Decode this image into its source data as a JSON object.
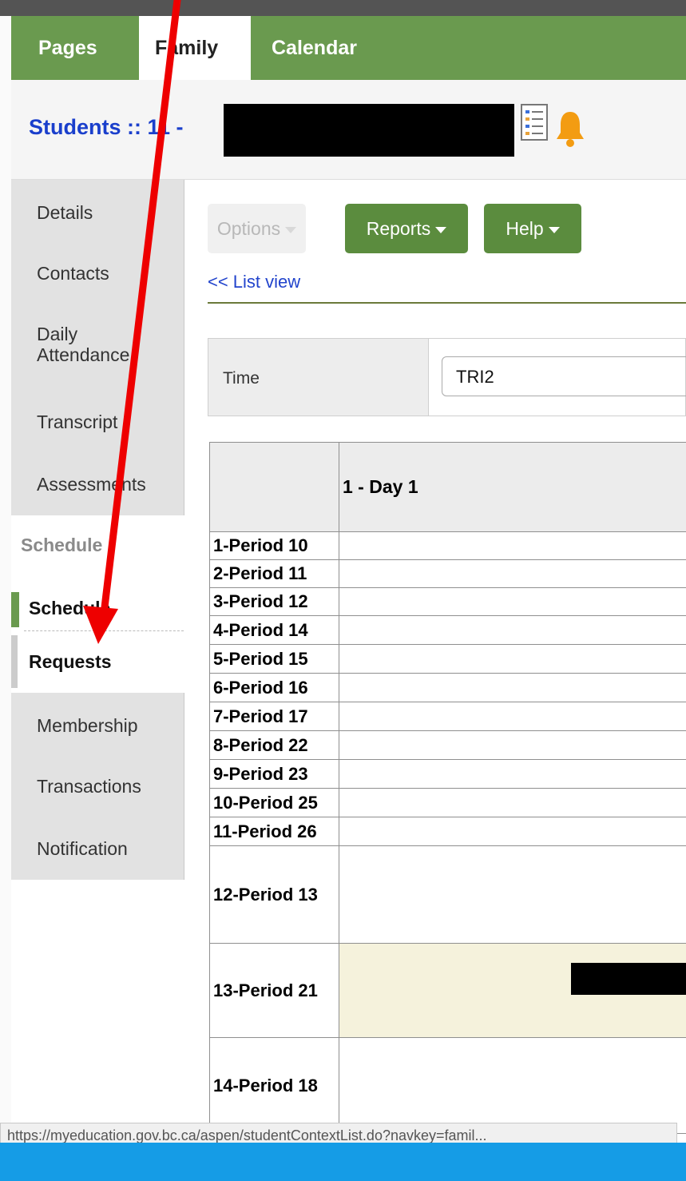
{
  "tabs": [
    {
      "label": "Pages",
      "active": false
    },
    {
      "label": "Family",
      "active": true
    },
    {
      "label": "Calendar",
      "active": false
    }
  ],
  "header": {
    "title": "Students :: 11 -"
  },
  "sidebar": {
    "items": [
      {
        "label": "Details"
      },
      {
        "label": "Contacts"
      },
      {
        "label": "Daily Attendance"
      },
      {
        "label": "Transcript"
      },
      {
        "label": "Assessments"
      }
    ],
    "section_label": "Schedule",
    "sub_items": [
      {
        "label": "Schedule"
      },
      {
        "label": "Requests"
      }
    ],
    "items_after": [
      {
        "label": "Membership"
      },
      {
        "label": "Transactions"
      },
      {
        "label": "Notification"
      }
    ]
  },
  "toolbar": {
    "options_label": "Options",
    "reports_label": "Reports",
    "help_label": "Help"
  },
  "list_view_link": "<< List view",
  "filter": {
    "label": "Time",
    "value": "TRI2"
  },
  "schedule": {
    "day_header": "1 - Day 1",
    "periods": [
      "1-Period 10",
      "2-Period 11",
      "3-Period 12",
      "4-Period 14",
      "5-Period 15",
      "6-Period 16",
      "7-Period 17",
      "8-Period 22",
      "9-Period 23",
      "10-Period 25",
      "11-Period 26",
      "12-Period 13",
      "13-Period 21",
      "14-Period 18"
    ]
  },
  "status_url": "https://myeducation.gov.bc.ca/aspen/studentContextList.do?navkey=famil...",
  "colors": {
    "tab_green": "#6a9a4f",
    "button_green": "#5b8c3e",
    "link_blue": "#2244cc",
    "annotation_red": "#ee0000",
    "taskbar_blue": "#159ce6"
  }
}
